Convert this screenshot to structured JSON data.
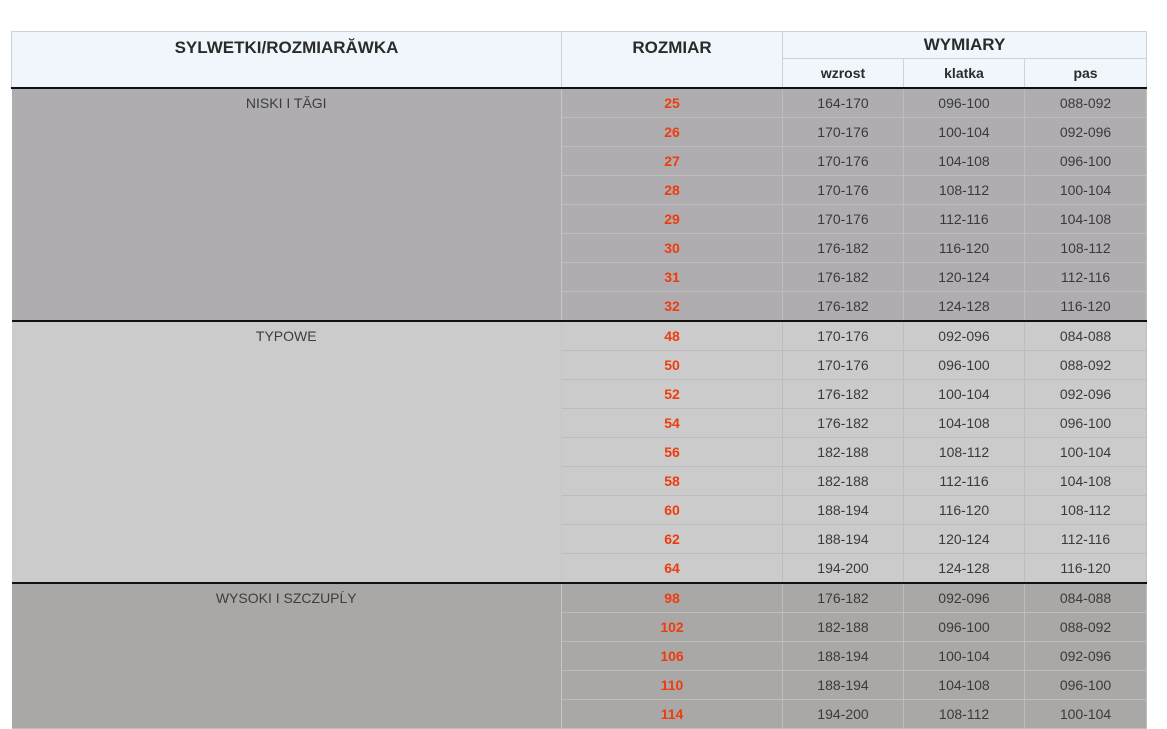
{
  "header": {
    "col_sil": "SYLWETKI/ROZMIARĂWKA",
    "col_size": "ROZMIAR",
    "col_meas": "WYMIARY",
    "sub_height": "wzrost",
    "sub_chest": "klatka",
    "sub_waist": "pas"
  },
  "groups": [
    {
      "label": "NISKI I TĂGI",
      "rows": [
        {
          "size": "25",
          "height": "164-170",
          "chest": "096-100",
          "waist": "088-092"
        },
        {
          "size": "26",
          "height": "170-176",
          "chest": "100-104",
          "waist": "092-096"
        },
        {
          "size": "27",
          "height": "170-176",
          "chest": "104-108",
          "waist": "096-100"
        },
        {
          "size": "28",
          "height": "170-176",
          "chest": "108-112",
          "waist": "100-104"
        },
        {
          "size": "29",
          "height": "170-176",
          "chest": "112-116",
          "waist": "104-108"
        },
        {
          "size": "30",
          "height": "176-182",
          "chest": "116-120",
          "waist": "108-112"
        },
        {
          "size": "31",
          "height": "176-182",
          "chest": "120-124",
          "waist": "112-116"
        },
        {
          "size": "32",
          "height": "176-182",
          "chest": "124-128",
          "waist": "116-120"
        }
      ]
    },
    {
      "label": "TYPOWE",
      "rows": [
        {
          "size": "48",
          "height": "170-176",
          "chest": "092-096",
          "waist": "084-088"
        },
        {
          "size": "50",
          "height": "170-176",
          "chest": "096-100",
          "waist": "088-092"
        },
        {
          "size": "52",
          "height": "176-182",
          "chest": "100-104",
          "waist": "092-096"
        },
        {
          "size": "54",
          "height": "176-182",
          "chest": "104-108",
          "waist": "096-100"
        },
        {
          "size": "56",
          "height": "182-188",
          "chest": "108-112",
          "waist": "100-104"
        },
        {
          "size": "58",
          "height": "182-188",
          "chest": "112-116",
          "waist": "104-108"
        },
        {
          "size": "60",
          "height": "188-194",
          "chest": "116-120",
          "waist": "108-112"
        },
        {
          "size": "62",
          "height": "188-194",
          "chest": "120-124",
          "waist": "112-116"
        },
        {
          "size": "64",
          "height": "194-200",
          "chest": "124-128",
          "waist": "116-120"
        }
      ]
    },
    {
      "label": "WYSOKI I SZCZUPĹY",
      "rows": [
        {
          "size": "98",
          "height": "176-182",
          "chest": "092-096",
          "waist": "084-088"
        },
        {
          "size": "102",
          "height": "182-188",
          "chest": "096-100",
          "waist": "088-092"
        },
        {
          "size": "106",
          "height": "188-194",
          "chest": "100-104",
          "waist": "092-096"
        },
        {
          "size": "110",
          "height": "188-194",
          "chest": "104-108",
          "waist": "096-100"
        },
        {
          "size": "114",
          "height": "194-200",
          "chest": "108-112",
          "waist": "100-104"
        }
      ]
    }
  ]
}
